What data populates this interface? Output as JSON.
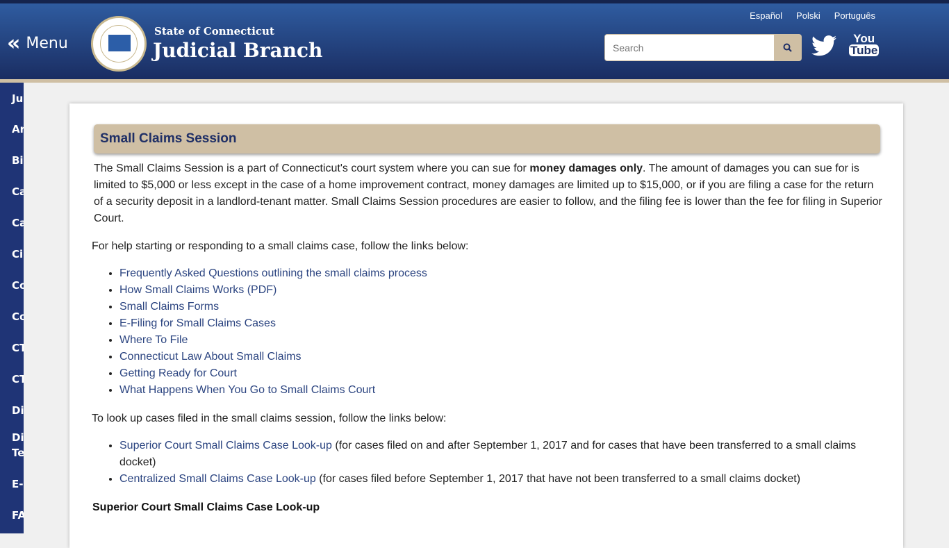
{
  "header": {
    "menu_label": "Menu",
    "subtitle": "State of Connecticut",
    "title": "Judicial Branch",
    "seal_text": "State of Connecticut Judicial Branch",
    "languages": [
      "Español",
      "Polski",
      "Português"
    ],
    "search_placeholder": "Search",
    "social": {
      "youtube_top": "You",
      "youtube_bottom": "Tube"
    }
  },
  "colors": {
    "header": "#2a4f8f",
    "sidebar": "#1f3476",
    "accent": "#cfbfa4",
    "link": "#2b4480"
  },
  "sidebar": {
    "items": [
      "Ju",
      "Ar",
      "Bi",
      "Ca",
      "Ca",
      "Ci",
      "Co",
      "Co",
      "CT",
      "CT",
      "Di",
      "Di",
      "Te",
      "E-S",
      "FA"
    ]
  },
  "main": {
    "heading": "Small Claims Session",
    "intro_1": "The Small Claims Session is a part of Connecticut's court system where you can sue for ",
    "intro_bold": "money damages only",
    "intro_2": ". The amount of damages you can sue for is limited to $5,000 or less except in the case of a home improvement contract, money damages are limited up to $15,000, or if you are filing a case for the return of a security deposit in a landlord-tenant matter. Small Claims Session procedures are easier to follow, and the filing fee is lower than the fee for filing in Superior Court.",
    "help_text": "For help starting or responding to a small claims case, follow the links below:",
    "help_links": [
      "Frequently Asked Questions outlining the small claims process",
      "How Small Claims Works (PDF)",
      "Small Claims Forms",
      "E-Filing for Small Claims Cases",
      "Where To File",
      "Connecticut Law About Small Claims",
      "Getting Ready for Court",
      "What Happens When You Go to Small Claims Court"
    ],
    "lookup_text": "To look up cases filed in the small claims session, follow the links below:",
    "lookup_links": [
      {
        "link": "Superior Court Small Claims Case Look-up",
        "rest": " (for cases filed on and after September 1, 2017 and for cases that have been transferred to a small claims docket)"
      },
      {
        "link": "Centralized Small Claims Case Look-up",
        "rest": " (for cases filed before September 1, 2017 that have not been transferred to a small claims docket)"
      }
    ],
    "section_heading": "Superior Court Small Claims Case Look-up"
  }
}
